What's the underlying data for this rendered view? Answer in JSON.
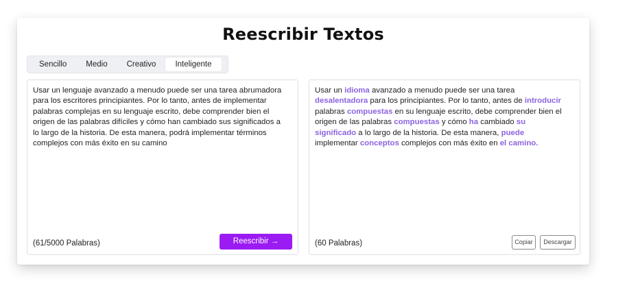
{
  "title": "Reescribir Textos",
  "tabs": [
    {
      "label": "Sencillo",
      "active": false
    },
    {
      "label": "Medio",
      "active": false
    },
    {
      "label": "Creativo",
      "active": false
    },
    {
      "label": "Inteligente",
      "active": true
    }
  ],
  "input_panel": {
    "text": "Usar un lenguaje avanzado a menudo puede ser una tarea abrumadora para los escritores principiantes. Por lo tanto, antes de implementar palabras complejas en su lenguaje escrito, debe comprender bien el origen de las palabras difíciles y cómo han cambiado sus significados a lo largo de la historia. De esta manera, podrá implementar términos complejos con más éxito en su camino",
    "word_count": "(61/5000 Palabras)",
    "rewrite_button": "Reescribir →"
  },
  "output_panel": {
    "segments": [
      {
        "text": "Usar un ",
        "highlight": false
      },
      {
        "text": "idioma",
        "highlight": true
      },
      {
        "text": " avanzado a menudo puede ser una tarea ",
        "highlight": false
      },
      {
        "text": "desalentadora",
        "highlight": true
      },
      {
        "text": " para los principiantes. Por lo tanto, antes de ",
        "highlight": false
      },
      {
        "text": "introducir",
        "highlight": true
      },
      {
        "text": " palabras ",
        "highlight": false
      },
      {
        "text": "compuestas",
        "highlight": true
      },
      {
        "text": " en su lenguaje escrito, debe comprender bien el origen de las palabras ",
        "highlight": false
      },
      {
        "text": "compuestas",
        "highlight": true
      },
      {
        "text": " y cómo ",
        "highlight": false
      },
      {
        "text": "ha",
        "highlight": true
      },
      {
        "text": " cambiado ",
        "highlight": false
      },
      {
        "text": "su significado",
        "highlight": true
      },
      {
        "text": " a lo largo de la historia. De esta manera, ",
        "highlight": false
      },
      {
        "text": "puede",
        "highlight": true
      },
      {
        "text": " implementar ",
        "highlight": false
      },
      {
        "text": "conceptos",
        "highlight": true
      },
      {
        "text": " complejos con más éxito en ",
        "highlight": false
      },
      {
        "text": "el camino.",
        "highlight": true
      }
    ],
    "word_count": "(60 Palabras)",
    "copy_button": "Copiar",
    "download_button": "Descargar"
  },
  "colors": {
    "accent": "#9a1cf2",
    "highlight": "#8b63e0"
  }
}
